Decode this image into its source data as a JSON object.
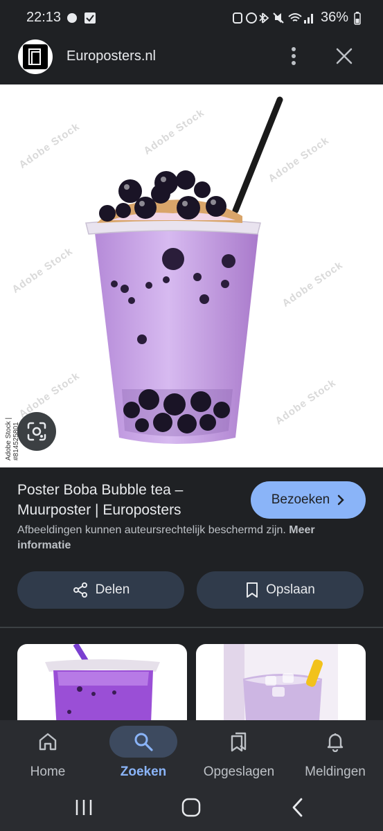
{
  "status": {
    "time": "22:13",
    "battery": "36%"
  },
  "header": {
    "site_name": "Europosters.nl"
  },
  "image": {
    "side_credit": "Adobe Stock | #814525801",
    "watermark": "Adobe Stock"
  },
  "result": {
    "title": "Poster Boba Bubble tea – Muurposter | Europosters",
    "visit_label": "Bezoeken",
    "copyright_text": "Afbeeldingen kunnen auteursrechtelijk beschermd zijn.",
    "more_info_label": "Meer informatie",
    "share_label": "Delen",
    "save_label": "Opslaan"
  },
  "nav": {
    "home": "Home",
    "search": "Zoeken",
    "saved": "Opgeslagen",
    "notifications": "Meldingen"
  },
  "colors": {
    "accent": "#8ab4f8",
    "background": "#1f2124",
    "button": "#303b4b"
  }
}
